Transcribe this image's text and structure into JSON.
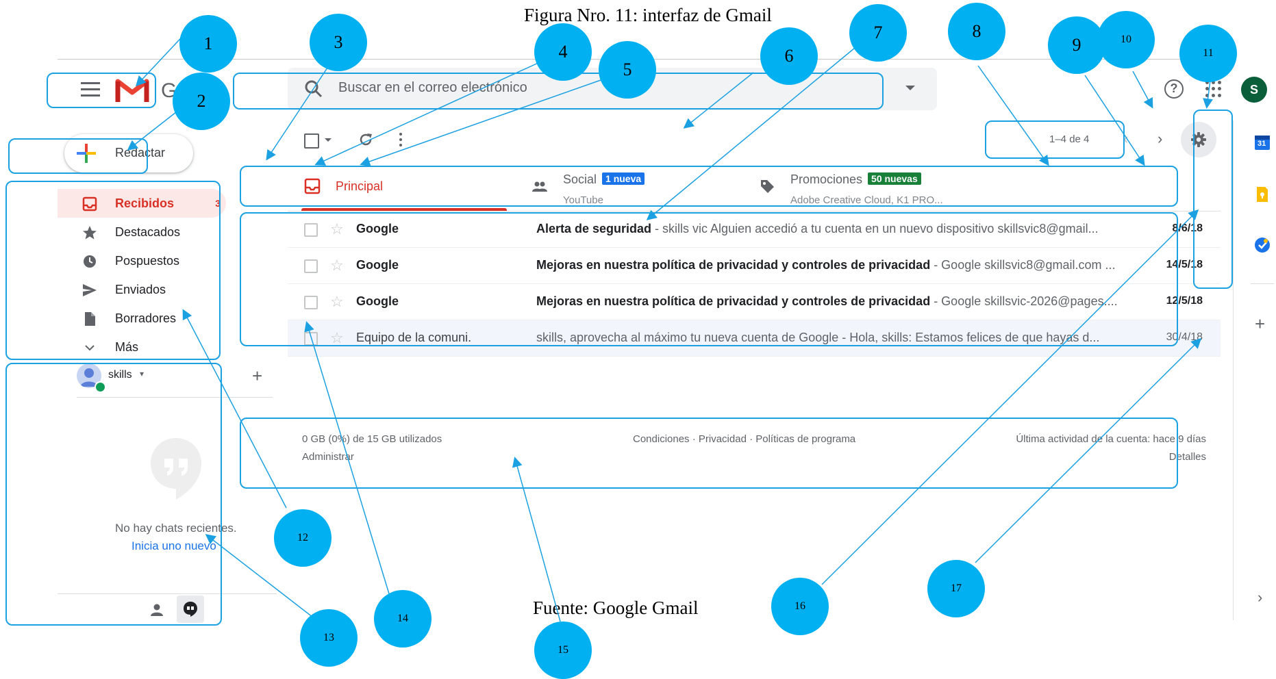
{
  "captions": {
    "title": "Figura Nro. 11: interfaz de Gmail",
    "source": "Fuente: Google Gmail"
  },
  "header": {
    "logo_letter": "G",
    "search_placeholder": "Buscar en el correo electrónico",
    "account_initial": "S"
  },
  "compose": {
    "label": "Redactar"
  },
  "sidebar": {
    "items": [
      {
        "label": "Recibidos",
        "icon": "inbox-icon",
        "count": "3",
        "active": true
      },
      {
        "label": "Destacados",
        "icon": "star-icon"
      },
      {
        "label": "Pospuestos",
        "icon": "clock-icon"
      },
      {
        "label": "Enviados",
        "icon": "send-icon"
      },
      {
        "label": "Borradores",
        "icon": "draft-icon"
      },
      {
        "label": "Más",
        "icon": "chevron-down-icon"
      }
    ]
  },
  "hangouts": {
    "user_name": "skills",
    "empty_text": "No hay chats recientes.",
    "start_link": "Inicia uno nuevo"
  },
  "toolbar": {
    "pager": "1–4 de 4"
  },
  "tabs": [
    {
      "name": "Principal",
      "icon": "inbox-icon",
      "color": "#d93025"
    },
    {
      "name": "Social",
      "badge": "1 nueva",
      "badge_color": "#1a73e8",
      "sub": "YouTube",
      "icon": "people-icon"
    },
    {
      "name": "Promociones",
      "badge": "50 nuevas",
      "badge_color": "#188038",
      "sub": "Adobe Creative Cloud, K1 PRO...",
      "icon": "tag-icon"
    }
  ],
  "emails": [
    {
      "sender": "Google",
      "subject": "Alerta de seguridad",
      "snippet": " - skills vic Alguien accedió a tu cuenta en un nuevo dispositivo skillsvic8@gmail...",
      "date": "8/6/18",
      "unread": true
    },
    {
      "sender": "Google",
      "subject": "Mejoras en nuestra política de privacidad y controles de privacidad",
      "snippet": " - Google skillsvic8@gmail.com ...",
      "date": "14/5/18",
      "unread": true
    },
    {
      "sender": "Google",
      "subject": "Mejoras en nuestra política de privacidad y controles de privacidad",
      "snippet": " - Google skillsvic-2026@pages....",
      "date": "12/5/18",
      "unread": true
    },
    {
      "sender": "Equipo de la comuni.",
      "subject": "skills, aprovecha al máximo tu nueva cuenta de Google",
      "snippet": " - Hola, skills: Estamos felices de que hayas d...",
      "date": "30/4/18",
      "unread": false
    }
  ],
  "footer": {
    "storage": "0 GB (0%) de 15 GB utilizados",
    "manage": "Administrar",
    "links": "Condiciones · Privacidad · Políticas de programa",
    "activity": "Última actividad de la cuenta: hace 9 días",
    "details": "Detalles"
  },
  "side_panel": {
    "calendar_day": "31",
    "icons": [
      "calendar-icon",
      "keep-icon",
      "tasks-icon",
      "add-icon",
      "chevron-right-icon"
    ]
  },
  "annotations": {
    "numbers": [
      "1",
      "2",
      "3",
      "4",
      "5",
      "6",
      "7",
      "8",
      "9",
      "10",
      "11",
      "12",
      "13",
      "14",
      "15",
      "16",
      "17"
    ],
    "color": "#00b0f0",
    "line_color": "#1ba1e2"
  }
}
